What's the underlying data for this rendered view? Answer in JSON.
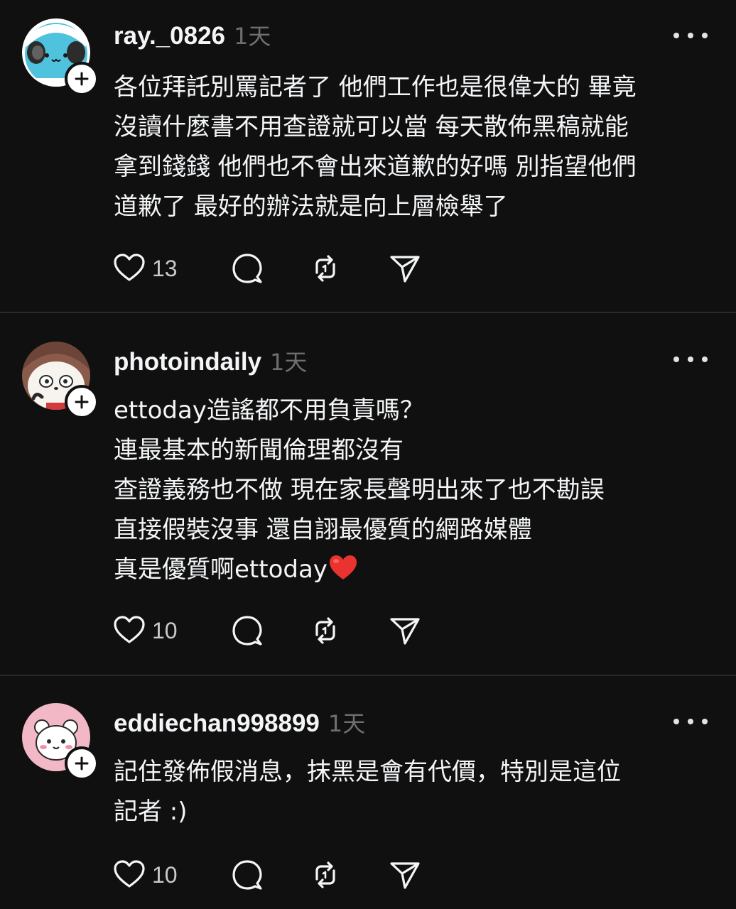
{
  "colors": {
    "background": "#101010",
    "text_primary": "#f3f5f7",
    "text_secondary": "#6f6f6f",
    "divider": "#2a2a2a"
  },
  "posts": [
    {
      "username": "ray._0826",
      "time": "1天",
      "avatar_icon": "blue-mask-character-avatar",
      "lines": [
        "各位拜託別罵記者了 他們工作也是很偉大的 畢竟",
        "沒讀什麼書不用查證就可以當 每天散佈黑稿就能",
        "拿到錢錢 他們也不會出來道歉的好嗎 別指望他們",
        "道歉了 最好的辦法就是向上層檢舉了"
      ],
      "likes": "13"
    },
    {
      "username": "photoindaily",
      "time": "1天",
      "avatar_icon": "panda-character-avatar",
      "lines": [
        "ettoday造謠都不用負責嗎？",
        "連最基本的新聞倫理都沒有",
        "查證義務也不做 現在家長聲明出來了也不勘誤",
        "直接假裝沒事 還自詡最優質的網路媒體",
        "真是優質啊ettoday"
      ],
      "likes": "10"
    },
    {
      "username": "eddiechan998899",
      "time": "1天",
      "avatar_icon": "bear-character-avatar",
      "lines": [
        "記住發佈假消息，抹黑是會有代價，特別是這位",
        "記者 :)"
      ],
      "likes": "10"
    }
  ]
}
